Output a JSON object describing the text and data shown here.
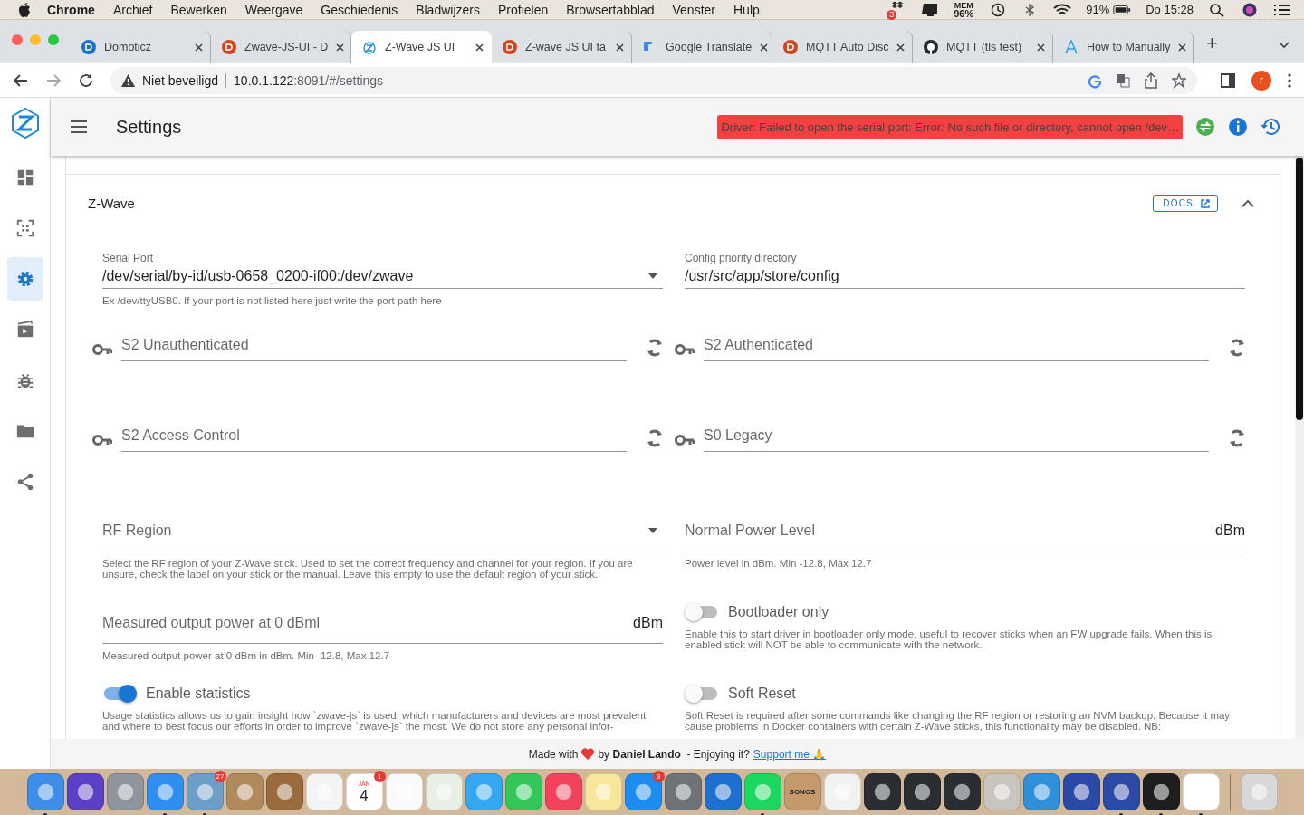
{
  "menubar": {
    "items": [
      {
        "label": "Chrome",
        "bold": true
      },
      {
        "label": "Archief",
        "bold": false
      },
      {
        "label": "Bewerken",
        "bold": false
      },
      {
        "label": "Weergave",
        "bold": false
      },
      {
        "label": "Geschiedenis",
        "bold": false
      },
      {
        "label": "Bladwijzers",
        "bold": false
      },
      {
        "label": "Profielen",
        "bold": false
      },
      {
        "label": "Browsertabblad",
        "bold": false
      },
      {
        "label": "Venster",
        "bold": false
      },
      {
        "label": "Hulp",
        "bold": false
      }
    ],
    "status": {
      "dropbox_badge": "3",
      "mem_label": "MEM",
      "mem_value": "96%",
      "battery": "91%",
      "clock": "Do 15:28"
    }
  },
  "browser": {
    "tabs": [
      {
        "title": "Domoticz",
        "selected": false
      },
      {
        "title": "Zwave-JS-UI - D",
        "selected": false
      },
      {
        "title": "Z-Wave JS UI",
        "selected": true
      },
      {
        "title": "Z-wave JS UI fa",
        "selected": false
      },
      {
        "title": "Google Translate",
        "selected": false
      },
      {
        "title": "MQTT Auto Disc",
        "selected": false
      },
      {
        "title": "MQTT (tls test)",
        "selected": false
      },
      {
        "title": "How to Manually",
        "selected": false
      }
    ],
    "new_tab": "+",
    "address": {
      "security": "Niet beveiligd",
      "host": "10.0.1.122",
      "path": ":8091/#/settings"
    },
    "profile": "r"
  },
  "app": {
    "title": "Settings",
    "error": "Driver: Failed to open the serial port: Error: No such file or directory, cannot open /dev…",
    "sidebar": [
      {
        "selected": false
      },
      {
        "selected": false
      },
      {
        "selected": true
      },
      {
        "selected": false
      },
      {
        "selected": false
      },
      {
        "selected": false
      },
      {
        "selected": false
      }
    ],
    "panel": {
      "title": "Z-Wave",
      "docs": "DOCS",
      "expanded": true,
      "fields": [
        {
          "kind": "select",
          "label": "Serial Port",
          "value": "/dev/serial/by-id/usb-0658_0200-if00:/dev/zwave",
          "hint": "Ex /dev/ttyUSB0. If your port is not listed here just write the port path here"
        },
        {
          "kind": "text",
          "label": "Config priority directory",
          "value": "/usr/src/app/store/config"
        },
        {
          "kind": "key",
          "placeholder": "S2 Unauthenticated"
        },
        {
          "kind": "key",
          "placeholder": "S2 Authenticated"
        },
        {
          "kind": "key",
          "placeholder": "S2 Access Control"
        },
        {
          "kind": "key",
          "placeholder": "S0 Legacy"
        },
        {
          "kind": "select",
          "placeholder": "RF Region",
          "hint": "Select the RF region of your Z-Wave stick. Used to set the correct frequency and channel for your region. If you are unsure, check the label on your stick or the manual. Leave this empty to use the default region of your stick."
        },
        {
          "kind": "number",
          "placeholder": "Normal Power Level",
          "suffix": "dBm",
          "hint": "Power level in dBm. Min -12.8, Max 12.7"
        },
        {
          "kind": "number",
          "placeholder": "Measured output power at 0 dBml",
          "suffix": "dBm",
          "hint": "Measured output power at 0 dBm in dBm. Min -12.8, Max 12.7"
        },
        {
          "kind": "switch",
          "label": "Bootloader only",
          "on": false,
          "hint": "Enable this to start driver in bootloader only mode, useful to recover sticks when an FW upgrade fails. When this is enabled stick will NOT be able to communicate with the network."
        },
        {
          "kind": "switch",
          "label": "Enable statistics",
          "on": true,
          "hint": "Usage statistics allows us to gain insight how `zwave-js` is used, which manufacturers and devices are most prevalent and where to best focus our efforts in order to improve `zwave-js` the most. We do not store any personal infor-"
        },
        {
          "kind": "switch",
          "label": "Soft Reset",
          "on": false,
          "hint": "Soft Reset is required after some commands like changing the RF region or restoring an NVM backup. Because it may cause problems in Docker containers with certain Z-Wave sticks, this functionality may be disabled. NB:"
        }
      ]
    },
    "footer": {
      "made_with": "Made with",
      "by": "by",
      "author": "Daniel Lando",
      "enjoy": "- Enjoying it?",
      "link": "Support me",
      "emoji": "🙏"
    }
  },
  "dock": [
    {
      "color": "#3d8ee8",
      "running": true
    },
    {
      "color": "#5b3fc4",
      "running": false
    },
    {
      "color": "#8e959c",
      "running": false
    },
    {
      "color": "#2f8ff0",
      "running": true
    },
    {
      "color": "#6d9ec8",
      "running": true,
      "badge": "27"
    },
    {
      "color": "#b08a5a",
      "running": false
    },
    {
      "color": "#9a6b3c",
      "running": false
    },
    {
      "color": "#f4f4f4",
      "running": false
    },
    {
      "color": "#ffffff",
      "running": false,
      "badge": "1",
      "month": "JAN",
      "day": "4"
    },
    {
      "color": "#fafafa",
      "running": false
    },
    {
      "color": "#e8f0e6",
      "running": false
    },
    {
      "color": "#34a8f5",
      "running": false
    },
    {
      "color": "#33c75a",
      "running": false
    },
    {
      "color": "#f3435c",
      "running": false
    },
    {
      "color": "#f8e79a",
      "running": false
    },
    {
      "color": "#1c8cf0",
      "running": false,
      "badge": "3"
    },
    {
      "color": "#6f7378",
      "running": false
    },
    {
      "color": "#1d6fd0",
      "running": false
    },
    {
      "color": "#1ed760",
      "running": true
    },
    {
      "color": "#c49a6c",
      "running": false,
      "label": "SONOS"
    },
    {
      "color": "#f2f2f2",
      "running": false
    },
    {
      "color": "#2a2d31",
      "running": false
    },
    {
      "color": "#2a2d31",
      "running": false
    },
    {
      "color": "#2a2d31",
      "running": false
    },
    {
      "color": "#c9c4bd",
      "running": false
    },
    {
      "color": "#2f8fd8",
      "running": false
    },
    {
      "color": "#2b4aa6",
      "running": false
    },
    {
      "color": "#2b4aa6",
      "running": true
    },
    {
      "color": "#1e1e1e",
      "running": true
    },
    {
      "color": "#ffffff",
      "running": true
    },
    {
      "color": "#d8d8d8",
      "running": false,
      "trash": true
    }
  ]
}
